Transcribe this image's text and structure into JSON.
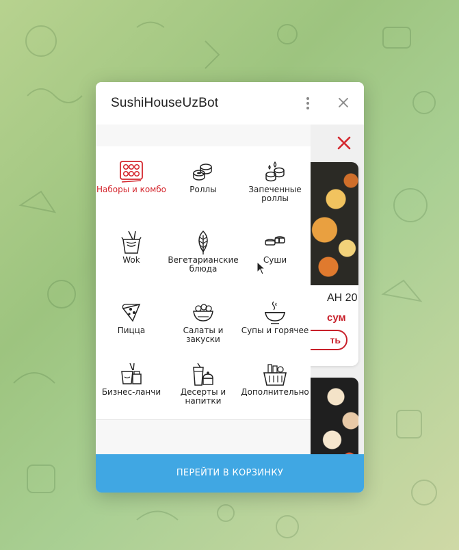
{
  "window": {
    "title": "SushiHouseUzBot"
  },
  "categories": [
    {
      "label": "Наборы и комбо",
      "icon": "sushi-set-icon",
      "active": true
    },
    {
      "label": "Роллы",
      "icon": "rolls-icon",
      "active": false
    },
    {
      "label": "Запеченные роллы",
      "icon": "baked-rolls-icon",
      "active": false
    },
    {
      "label": "Wok",
      "icon": "wok-box-icon",
      "active": false
    },
    {
      "label": "Вегетарианские блюда",
      "icon": "leaf-icon",
      "active": false
    },
    {
      "label": "Суши",
      "icon": "sushi-icon",
      "active": false
    },
    {
      "label": "Пицца",
      "icon": "pizza-slice-icon",
      "active": false
    },
    {
      "label": "Салаты и закуски",
      "icon": "salad-bowl-icon",
      "active": false
    },
    {
      "label": "Супы и горячее",
      "icon": "soup-bowl-icon",
      "active": false
    },
    {
      "label": "Бизнес-ланчи",
      "icon": "lunch-box-icon",
      "active": false
    },
    {
      "label": "Десерты и напитки",
      "icon": "drink-cake-icon",
      "active": false
    },
    {
      "label": "Дополнительно",
      "icon": "basket-icon",
      "active": false
    }
  ],
  "peek": {
    "product_name": "АН 20",
    "price": "сум",
    "button": "ть"
  },
  "checkout": {
    "label": "ПЕРЕЙТИ В КОРЗИНКУ"
  },
  "colors": {
    "accent_red": "#d4262d",
    "button_blue": "#40a7e3"
  }
}
